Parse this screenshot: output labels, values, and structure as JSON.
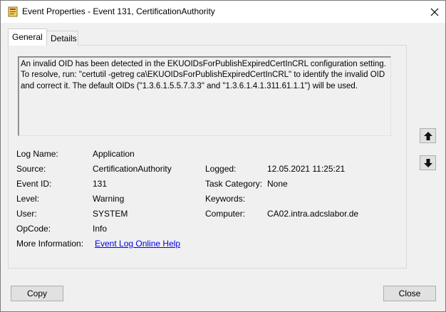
{
  "window": {
    "title": "Event Properties - Event 131, CertificationAuthority"
  },
  "tabs": [
    {
      "label": "General"
    },
    {
      "label": "Details"
    }
  ],
  "description": "An invalid OID has been detected in the EKUOIDsForPublishExpiredCertInCRL configuration setting. To resolve, run: \"certutil -getreg ca\\EKUOIDsForPublishExpiredCertInCRL\" to identify the invalid OID and correct it. The default OIDs (\"1.3.6.1.5.5.7.3.3\" and \"1.3.6.1.4.1.311.61.1.1\") will be used.",
  "fields": {
    "log_name": {
      "label": "Log Name:",
      "value": "Application"
    },
    "source": {
      "label": "Source:",
      "value": "CertificationAuthority"
    },
    "logged": {
      "label": "Logged:",
      "value": "12.05.2021 11:25:21"
    },
    "event_id": {
      "label": "Event ID:",
      "value": "131"
    },
    "task_category": {
      "label": "Task Category:",
      "value": "None"
    },
    "level": {
      "label": "Level:",
      "value": "Warning"
    },
    "keywords": {
      "label": "Keywords:",
      "value": ""
    },
    "user": {
      "label": "User:",
      "value": "SYSTEM"
    },
    "computer": {
      "label": "Computer:",
      "value": "CA02.intra.adcslabor.de"
    },
    "opcode": {
      "label": "OpCode:",
      "value": "Info"
    },
    "more_info": {
      "label": "More Information:",
      "link_text": "Event Log Online Help"
    }
  },
  "buttons": {
    "copy": "Copy",
    "close": "Close"
  },
  "icons": {
    "title": "event-properties-icon",
    "up": "arrow-up-icon",
    "down": "arrow-down-icon",
    "close": "close-icon"
  }
}
